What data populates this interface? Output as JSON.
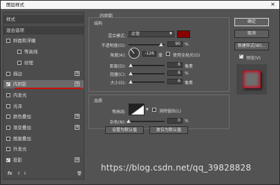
{
  "window": {
    "title": "图层样式",
    "close_glyph": "✕"
  },
  "left_panel": {
    "items": [
      {
        "label": "样式",
        "checkbox": false,
        "checked": false,
        "plus": false,
        "header": true
      },
      {
        "label": "混合选项",
        "checkbox": false,
        "checked": false,
        "plus": false,
        "header": true
      },
      {
        "label": "斜面和浮雕",
        "checkbox": true,
        "checked": false,
        "plus": false
      },
      {
        "label": "等高线",
        "checkbox": true,
        "checked": false,
        "plus": false,
        "indent": true
      },
      {
        "label": "纹理",
        "checkbox": true,
        "checked": false,
        "plus": false,
        "indent": true
      },
      {
        "label": "描边",
        "checkbox": true,
        "checked": false,
        "plus": true
      },
      {
        "label": "内阴影",
        "checkbox": true,
        "checked": true,
        "plus": true,
        "selected": true
      },
      {
        "label": "内发光",
        "checkbox": true,
        "checked": false,
        "plus": false
      },
      {
        "label": "光泽",
        "checkbox": true,
        "checked": false,
        "plus": false
      },
      {
        "label": "颜色叠加",
        "checkbox": true,
        "checked": false,
        "plus": true
      },
      {
        "label": "渐变叠加",
        "checkbox": true,
        "checked": false,
        "plus": true
      },
      {
        "label": "图案叠加",
        "checkbox": true,
        "checked": false,
        "plus": false
      },
      {
        "label": "外发光",
        "checkbox": true,
        "checked": false,
        "plus": false
      },
      {
        "label": "投影",
        "checkbox": true,
        "checked": true,
        "plus": true
      }
    ],
    "footer": {
      "fx": "fx",
      "up": "⇧",
      "down": "⇩",
      "trash": "🗑"
    }
  },
  "inner_shadow": {
    "title": "内阴影",
    "structure": {
      "title": "结构",
      "blend_mode_label": "混合模式:",
      "blend_mode_value": "正常",
      "color": "#8c0000",
      "opacity_label": "不透明度(O):",
      "opacity_value": "90",
      "opacity_unit": "%",
      "opacity_fraction": 0.9,
      "angle_label": "角度(A):",
      "angle_value": "-126",
      "angle_unit": "度",
      "global_light_label": "使用全局光(G)",
      "distance_label": "距离(D):",
      "distance_value": "6",
      "distance_unit": "像素",
      "distance_fraction": 0.05,
      "choke_label": "阻塞(C):",
      "choke_value": "6",
      "choke_unit": "%",
      "choke_fraction": 0.06,
      "size_label": "大小(S):",
      "size_value": "6",
      "size_unit": "像素",
      "size_fraction": 0.05
    },
    "quality": {
      "title": "品质",
      "contour_label": "等高线:",
      "anti_alias_label": "消除锯齿(L)",
      "noise_label": "杂色(N):",
      "noise_value": "0",
      "noise_unit": "%",
      "noise_fraction": 0.0
    },
    "make_default_label": "设置为默认值",
    "reset_default_label": "复位为默认值"
  },
  "right_panel": {
    "ok_label": "确定",
    "cancel_label": "取消",
    "new_style_label": "新建样式(W)...",
    "preview_label": "预览(V)",
    "preview_checked": true
  },
  "watermark": "https://blog.csdn.net/qq_39828828"
}
